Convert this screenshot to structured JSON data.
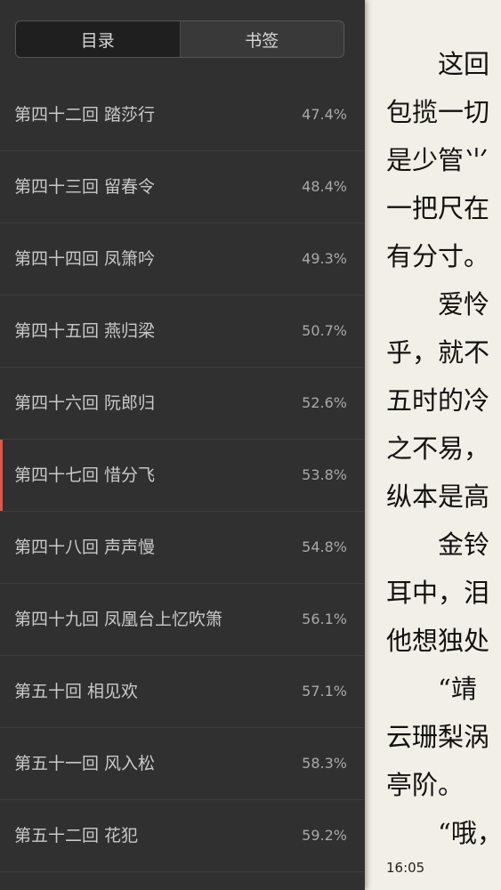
{
  "drawer": {
    "tabs": [
      {
        "label": "目录",
        "active": true
      },
      {
        "label": "书签",
        "active": false
      }
    ],
    "chapters": [
      {
        "title": "第四十二回 踏莎行",
        "percent": "47.4%",
        "current": false
      },
      {
        "title": "第四十三回 留春令",
        "percent": "48.4%",
        "current": false
      },
      {
        "title": "第四十四回 凤箫吟",
        "percent": "49.3%",
        "current": false
      },
      {
        "title": "第四十五回 燕归梁",
        "percent": "50.7%",
        "current": false
      },
      {
        "title": "第四十六回 阮郎归",
        "percent": "52.6%",
        "current": false
      },
      {
        "title": "第四十七回 惜分飞",
        "percent": "53.8%",
        "current": true
      },
      {
        "title": "第四十八回 声声慢",
        "percent": "54.8%",
        "current": false
      },
      {
        "title": "第四十九回 凤凰台上忆吹箫",
        "percent": "56.1%",
        "current": false
      },
      {
        "title": "第五十回 相见欢",
        "percent": "57.1%",
        "current": false
      },
      {
        "title": "第五十一回 风入松",
        "percent": "58.3%",
        "current": false
      },
      {
        "title": "第五十二回 花犯",
        "percent": "59.2%",
        "current": false
      }
    ],
    "accent_color": "#e0564a"
  },
  "page": {
    "lines": [
      "　　这回",
      "包揽一切",
      "是少管⺌",
      "一把尺在",
      "有分寸。",
      "　　爱怜",
      "乎，就不",
      "五时的冷",
      "之不易，",
      "纵本是高",
      "　　金铃",
      "耳中，泪",
      "他想独处",
      "　　“靖",
      "云珊梨涡",
      "亭阶。",
      "　　“哦，"
    ],
    "time": "16:05"
  }
}
